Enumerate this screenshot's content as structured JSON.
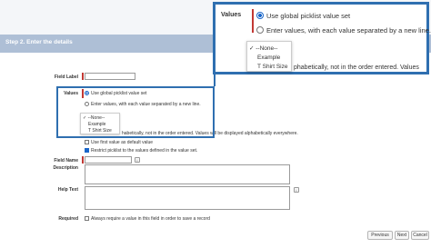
{
  "step_header": "Step 2. Enter the details",
  "labels": {
    "field_label": "Field Label",
    "values": "Values",
    "field_name": "Field Name",
    "description": "Description",
    "help_text": "Help Text",
    "required": "Required"
  },
  "values_options": {
    "global": "Use global picklist value set",
    "enter": "Enter values, with each value separated by a new line."
  },
  "dropdown": {
    "items": [
      "--None--",
      "Example",
      "T Shirt Size"
    ]
  },
  "notes": {
    "alpha_small": "habetically, not in the order entered. Values will be displayed alphabetically everywhere.",
    "alpha_big": "phabetically, not in the order entered. Values"
  },
  "checkboxes": {
    "first_default": "Use first value as default value",
    "restrict": "Restrict picklist to the values defined in the value set."
  },
  "required_text": "Always require a value in this field in order to save a record",
  "info_glyph": "i",
  "buttons": {
    "previous": "Previous",
    "next": "Next",
    "cancel": "Cancel"
  },
  "colors": {
    "accent": "#2f6fb0",
    "required": "#c23934",
    "step_bar": "#aebfd6"
  }
}
